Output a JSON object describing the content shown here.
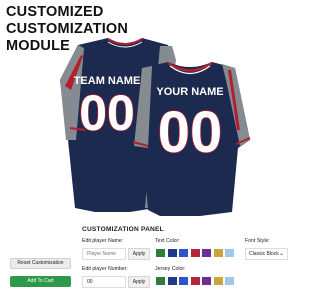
{
  "header": {
    "lines": [
      "CUSTOMIZED",
      "CUSTOMIZATION",
      "MODULE"
    ]
  },
  "jersey": {
    "back_name": "TEAM NAME",
    "back_number": "00",
    "front_name": "YOUR NAME",
    "front_number": "00",
    "colors": {
      "body": "#1d2a4f",
      "panel": "#868b92",
      "accent": "#b21f2d",
      "trim": "#ffffff"
    }
  },
  "panel": {
    "title": "CUSTOMIZATION PANEL",
    "player_name_label": "Edit player Name:",
    "player_name_placeholder": "Player Name",
    "player_number_label": "Edit player Number:",
    "player_number_value": "00",
    "apply_label": "Apply",
    "text_color_label": "Text Color:",
    "jersey_color_label": "Jersey Color:",
    "font_style_label": "Font Style:",
    "font_style_value": "Classic Block",
    "swatches": [
      "#2f7d3a",
      "#1e3a8a",
      "#2f53c9",
      "#b3263b",
      "#6b2f91",
      "#c9a53a",
      "#9fc7e8"
    ]
  },
  "actions": {
    "reset_label": "Reset Customization",
    "cart_label": "Add To Cart"
  }
}
